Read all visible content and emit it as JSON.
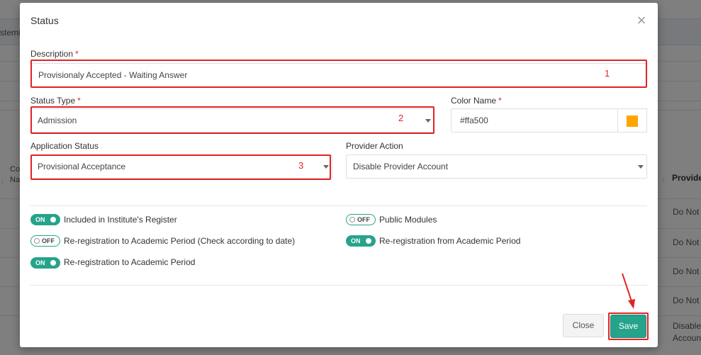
{
  "background": {
    "topbar_text": "stemi",
    "left_col": [
      "Co",
      "Na"
    ],
    "right_col_header": "Provide",
    "rows": [
      "Do Not",
      "Do Not",
      "Do Not",
      "Do Not",
      "Disable",
      "Accoun"
    ]
  },
  "modal": {
    "title": "Status",
    "close_icon": "close-icon",
    "description": {
      "label": "Description",
      "required": "*",
      "value": "Provisionaly Accepted - Waiting Answer"
    },
    "status_type": {
      "label": "Status Type",
      "required": "*",
      "value": "Admission"
    },
    "color_name": {
      "label": "Color Name",
      "required": "*",
      "value": "#ffa500",
      "swatch": "#ffa500"
    },
    "application_status": {
      "label": "Application Status",
      "value": "Provisional Acceptance"
    },
    "provider_action": {
      "label": "Provider Action",
      "value": "Disable Provider Account"
    },
    "annotations": [
      "1",
      "2",
      "3"
    ],
    "toggles": [
      {
        "state": "ON",
        "on": true,
        "label": "Included in Institute's Register"
      },
      {
        "state": "OFF",
        "on": false,
        "label": "Public Modules"
      },
      {
        "state": "OFF",
        "on": false,
        "label": "Re-registration to Academic Period (Check according to date)"
      },
      {
        "state": "ON",
        "on": true,
        "label": "Re-registration from Academic Period"
      },
      {
        "state": "ON",
        "on": true,
        "label": "Re-registration to Academic Period"
      }
    ],
    "buttons": {
      "close": "Close",
      "save": "Save"
    }
  },
  "colors": {
    "accent": "#26a38b",
    "highlight": "#e02424"
  }
}
